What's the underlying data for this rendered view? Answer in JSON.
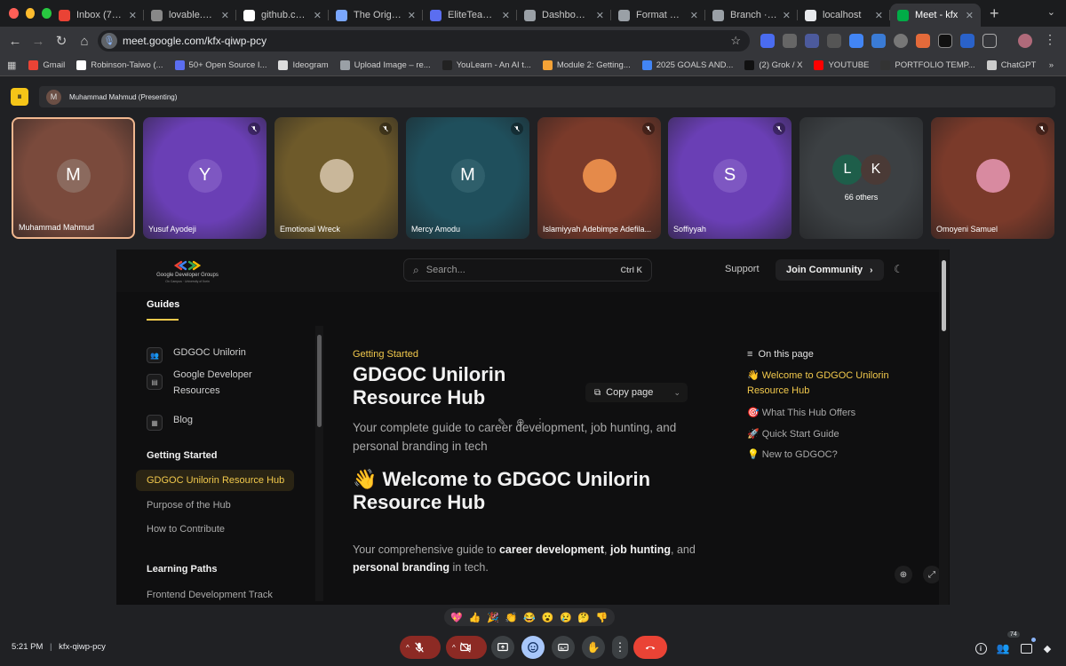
{
  "browser": {
    "tabs": [
      {
        "label": "Inbox (7,755)",
        "icon": "gmail-icon",
        "color": "#ea4335"
      },
      {
        "label": "lovable.dev",
        "icon": "lovable-icon",
        "color": "#888888"
      },
      {
        "label": "github.com",
        "icon": "github-icon",
        "color": "#ffffff"
      },
      {
        "label": "The Originato",
        "icon": "loading-icon",
        "color": "#7aa7ff"
      },
      {
        "label": "EliteTeam_Sk",
        "icon": "shield-icon",
        "color": "#5b6ef0"
      },
      {
        "label": "Dashboard op",
        "icon": "globe-icon",
        "color": "#9aa0a6"
      },
      {
        "label": "Format exam",
        "icon": "globe-icon",
        "color": "#9aa0a6"
      },
      {
        "label": "Branch · Bran",
        "icon": "globe-icon",
        "color": "#9aa0a6"
      },
      {
        "label": "localhost",
        "icon": "warning-icon",
        "color": "#e8eaed"
      },
      {
        "label": "Meet - kfx",
        "icon": "meet-icon",
        "color": "#00ac47",
        "active": true
      }
    ],
    "url": "meet.google.com/kfx-qiwp-pcy",
    "bookmarks": [
      {
        "label": "Gmail",
        "color": "#ea4335"
      },
      {
        "label": "Robinson-Taiwo (...",
        "color": "#ffffff"
      },
      {
        "label": "50+ Open Source I...",
        "color": "#5b6ef0"
      },
      {
        "label": "Ideogram",
        "color": "#dddddd"
      },
      {
        "label": "Upload Image – re...",
        "color": "#9aa0a6"
      },
      {
        "label": "YouLearn - An AI t...",
        "color": "#222222"
      },
      {
        "label": "Module 2: Getting...",
        "color": "#f4a236"
      },
      {
        "label": "2025 GOALS AND...",
        "color": "#4285f4"
      },
      {
        "label": "(2) Grok / X",
        "color": "#111111"
      },
      {
        "label": "YOUTUBE",
        "color": "#ff0000"
      },
      {
        "label": "PORTFOLIO TEMP...",
        "color": "#333333"
      },
      {
        "label": "ChatGPT",
        "color": "#cccccc"
      }
    ]
  },
  "meet": {
    "presenting": "Muhammad Mahmud (Presenting)",
    "presenter_initial": "M",
    "participants": [
      {
        "name": "Muhammad Mahmud",
        "initial": "M",
        "bg": "#7a4a3c",
        "avatar_bg": "#8b6a5e",
        "speaking": true,
        "muted": false
      },
      {
        "name": "Yusuf Ayodeji",
        "initial": "Y",
        "bg": "#6a3fb5",
        "avatar_bg": "#7e57c2",
        "muted": true
      },
      {
        "name": "Emotional Wreck",
        "initial": "",
        "bg": "#6e5a2a",
        "avatar_bg": "#c9b79a",
        "muted": true,
        "photo": true
      },
      {
        "name": "Mercy Amodu",
        "initial": "M",
        "bg": "#1f4f5c",
        "avatar_bg": "#2f5f6b",
        "muted": true
      },
      {
        "name": "Islamiyyah Adebimpe Adefila...",
        "initial": "",
        "bg": "#7a3a2a",
        "avatar_bg": "#e58a4a",
        "muted": true,
        "photo": true
      },
      {
        "name": "Soffiyyah",
        "initial": "S",
        "bg": "#6a3fb5",
        "avatar_bg": "#7e57c2",
        "muted": true
      },
      {
        "name": "66 others",
        "initials": [
          "L",
          "K"
        ],
        "bg": "#3c4043"
      },
      {
        "name": "Omoyeni Samuel",
        "initial": "",
        "bg": "#7a3a2a",
        "avatar_bg": "#d88aa0",
        "muted": true,
        "photo": true
      }
    ],
    "reactions": [
      "💖",
      "👍",
      "🎉",
      "👏",
      "😂",
      "😮",
      "😢",
      "🤔",
      "👎"
    ],
    "time": "5:21 PM",
    "meeting_code": "kfx-qiwp-pcy",
    "participant_count": "74"
  },
  "shared_site": {
    "logo_line1": "Google Developer Groups",
    "logo_line2": "On Campus · University of Ilorin",
    "search_placeholder": "Search...",
    "search_shortcut": "Ctrl K",
    "support": "Support",
    "join": "Join Community",
    "guides_tab": "Guides",
    "sidebar_items": [
      "GDGOC Unilorin",
      "Google Developer Resources",
      "Blog"
    ],
    "section_getting_started": "Getting Started",
    "active_item": "GDGOC Unilorin Resource Hub",
    "links": [
      "Purpose of the Hub",
      "How to Contribute"
    ],
    "section_learning": "Learning Paths",
    "learning_link": "Frontend Development Track",
    "kicker": "Getting Started",
    "title": "GDGOC Unilorin Resource Hub",
    "subtitle": "Your complete guide to career development, job hunting, and personal branding in tech",
    "copy_page": "Copy page",
    "welcome": "👋 Welcome to GDGOC Unilorin Resource Hub",
    "intro_1": "Your comprehensive guide to ",
    "intro_b1": "career development",
    "intro_2": ", ",
    "intro_b2": "job hunting",
    "intro_3": ", and ",
    "intro_b3": "personal branding",
    "intro_4": " in tech.",
    "toc_title": "On this page",
    "toc": [
      {
        "label": "👋 Welcome to GDGOC Unilorin Resource Hub",
        "active": true
      },
      {
        "label": "🎯 What This Hub Offers"
      },
      {
        "label": "🚀 Quick Start Guide"
      },
      {
        "label": "💡 New to GDGOC?"
      }
    ]
  }
}
